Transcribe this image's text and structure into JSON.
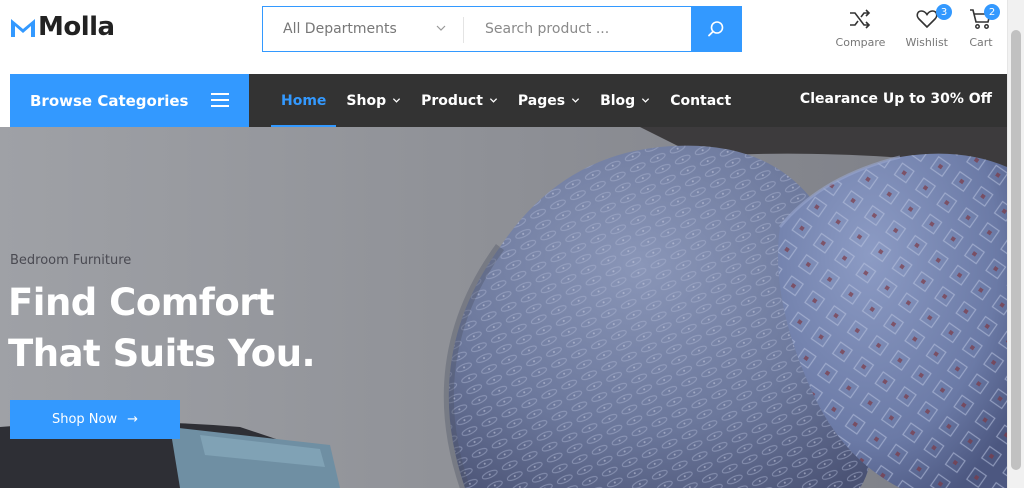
{
  "header": {
    "logo_text": "Molla",
    "search": {
      "department": "All Departments",
      "placeholder": "Search product ..."
    },
    "icons": [
      {
        "name": "compare-icon",
        "label": "Compare"
      },
      {
        "name": "heart-icon",
        "label": "Wishlist",
        "badge": "3"
      },
      {
        "name": "cart-icon",
        "label": "Cart",
        "badge": "2"
      }
    ]
  },
  "nav": {
    "browse_label": "Browse Categories",
    "items": [
      {
        "label": "Home",
        "active": true
      },
      {
        "label": "Shop",
        "dropdown": true
      },
      {
        "label": "Product",
        "dropdown": true
      },
      {
        "label": "Pages",
        "dropdown": true
      },
      {
        "label": "Blog",
        "dropdown": true
      },
      {
        "label": "Contact"
      }
    ],
    "promo": "Clearance Up to 30% Off"
  },
  "hero": {
    "subtitle": "Bedroom Furniture",
    "title_line1": "Find Comfort",
    "title_line2": "That Suits You.",
    "button_label": "Shop Now",
    "button_arrow": "→"
  },
  "colors": {
    "accent": "#3399ff",
    "nav_bg": "#333333",
    "text_dark": "#222222"
  }
}
